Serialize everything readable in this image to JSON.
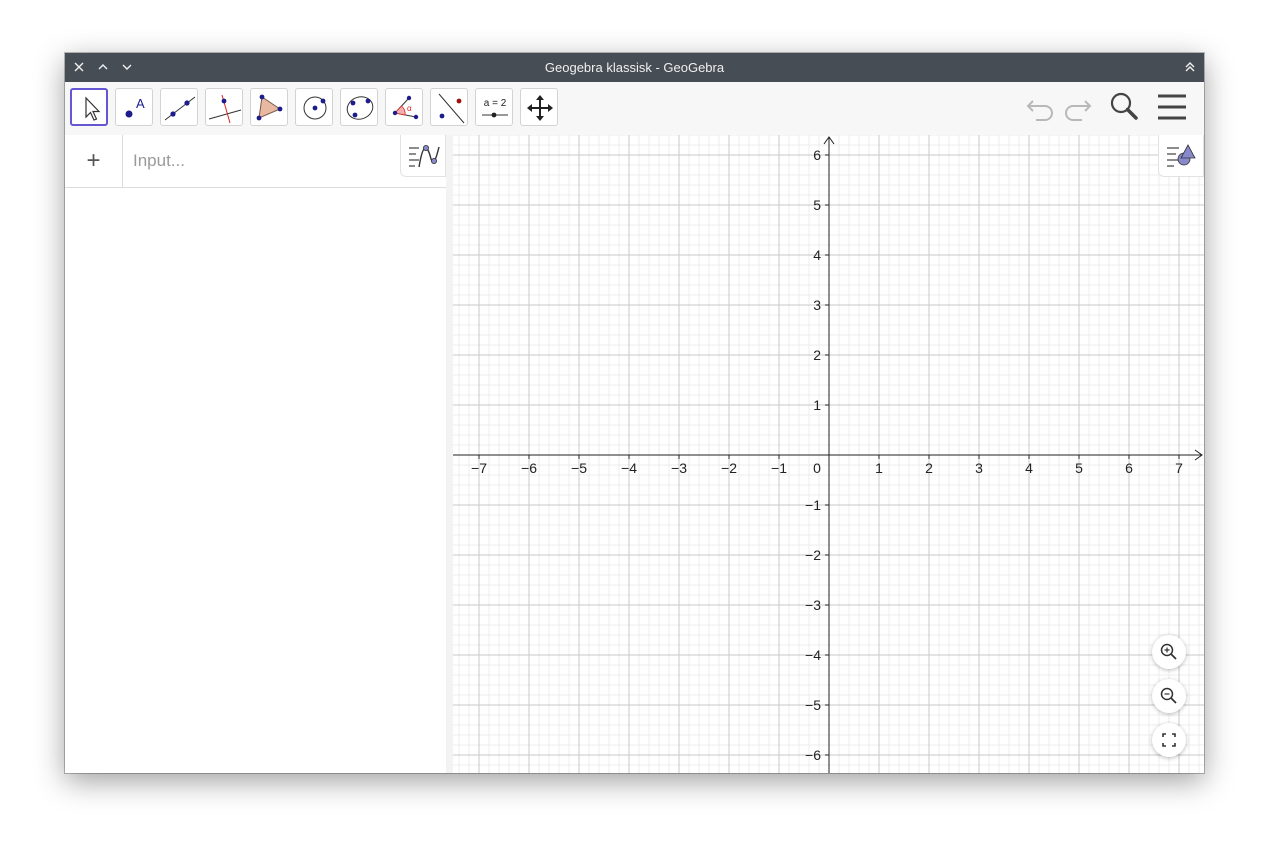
{
  "window": {
    "title": "Geogebra klassisk - GeoGebra"
  },
  "titlebar_buttons": [
    "close-icon",
    "minimize-icon",
    "maximize-icon",
    "keep-above-icon"
  ],
  "toolbar": {
    "tools": [
      {
        "name": "move-tool",
        "icon": "cursor-arrow-icon",
        "active": true
      },
      {
        "name": "point-tool",
        "icon": "point-A-icon",
        "label": "A"
      },
      {
        "name": "line-tool",
        "icon": "line-through-two-points-icon"
      },
      {
        "name": "perpendicular-line-tool",
        "icon": "perpendicular-line-icon"
      },
      {
        "name": "polygon-tool",
        "icon": "triangle-icon"
      },
      {
        "name": "circle-tool",
        "icon": "circle-center-point-icon"
      },
      {
        "name": "conic-tool",
        "icon": "ellipse-icon"
      },
      {
        "name": "angle-tool",
        "icon": "angle-icon"
      },
      {
        "name": "reflect-tool",
        "icon": "reflect-about-line-icon"
      },
      {
        "name": "slider-tool",
        "icon": "slider-icon",
        "label": "a = 2"
      },
      {
        "name": "move-graphics-view-tool",
        "icon": "move-arrows-icon"
      }
    ],
    "right": [
      "undo-icon",
      "redo-icon",
      "search-icon",
      "menu-icon"
    ]
  },
  "algebra": {
    "plus": "+",
    "input_placeholder": "Input..."
  },
  "graphics": {
    "x_ticks": [
      "−7",
      "−6",
      "−5",
      "−4",
      "−3",
      "−2",
      "−1",
      "0",
      "1",
      "2",
      "3",
      "4",
      "5",
      "6",
      "7"
    ],
    "y_ticks": [
      "6",
      "5",
      "4",
      "3",
      "2",
      "1",
      "−1",
      "−2",
      "−3",
      "−4",
      "−5",
      "−6"
    ],
    "x_range": [
      -7.5,
      7.5
    ],
    "y_range": [
      -6.4,
      6.4
    ],
    "grid": true
  },
  "zoom_buttons": [
    "zoom-in-icon",
    "zoom-out-icon",
    "fullscreen-icon"
  ],
  "colors": {
    "titlebar": "#474d54",
    "accent": "#6557d2",
    "point": "#1c1c8c",
    "grid": "#c8c8c8",
    "subgrid": "#ececec"
  }
}
